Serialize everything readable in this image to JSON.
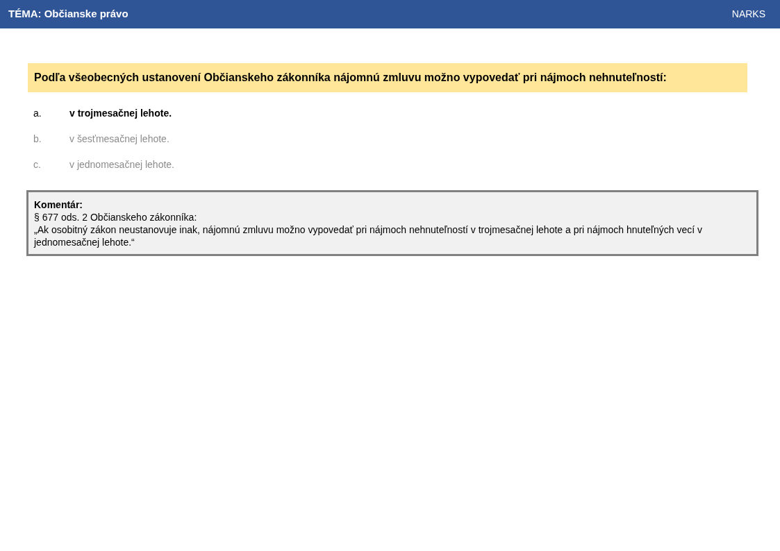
{
  "header": {
    "title": "TÉMA: Občianske právo",
    "brand": "NARKS"
  },
  "question": "Podľa všeobecných ustanovení Občianskeho zákonníka nájomnú zmluvu možno vypovedať pri nájmoch nehnuteľností:",
  "answers": [
    {
      "letter": "a.",
      "text": "v trojmesačnej lehote.",
      "selected": true
    },
    {
      "letter": "b.",
      "text": "v šesťmesačnej lehote.",
      "selected": false
    },
    {
      "letter": "c.",
      "text": "v jednomesačnej lehote.",
      "selected": false
    }
  ],
  "comment": {
    "heading": "Komentár:",
    "source": "§ 677 ods. 2 Občianskeho zákonníka:",
    "quote": "„Ak osobitný zákon neustanovuje inak, nájomnú zmluvu možno vypovedať pri nájmoch nehnuteľností v trojmesačnej lehote a pri nájmoch hnuteľných vecí v jednomesačnej lehote.“"
  }
}
